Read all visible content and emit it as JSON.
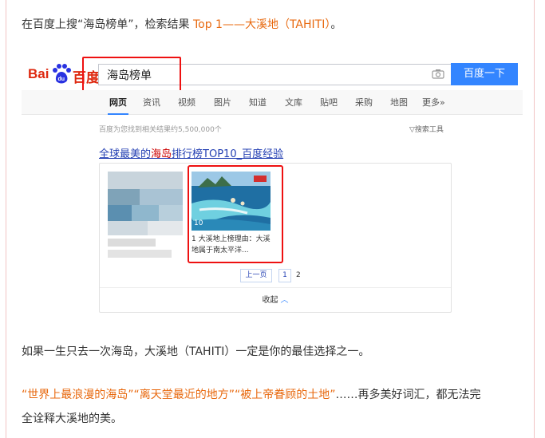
{
  "article": {
    "line1_prefix": "在百度上搜“海岛榜单”，检索结果",
    "line1_highlight": "Top 1——大溪地（TAHITI）",
    "line1_suffix": "。",
    "line2": "如果一生只去一次海岛，大溪地（TAHITI）一定是你的最佳选择之一。",
    "line3_highlight": "“世界上最浪漫的海岛”“离天堂最近的地方”“被上帝眷顾的土地”",
    "line3_suffix": "……再多美好词汇，都无法完",
    "line4": "全诠释大溪地的美。"
  },
  "baidu": {
    "logo_left": "Bai",
    "logo_right": "百度",
    "logo_du": "du",
    "query": "海岛榜单",
    "search_button": "百度一下",
    "tabs": [
      "网页",
      "资讯",
      "视频",
      "图片",
      "知道",
      "文库",
      "贴吧",
      "采购",
      "地图",
      "更多»"
    ],
    "result_count": "百度为您找到相关结果约5,500,000个",
    "search_tools": "▽搜索工具",
    "result_title_pre": "全球最美的",
    "result_title_red": "海岛",
    "result_title_post": "排行榜TOP10_百度经验",
    "thumb_badge": "10",
    "thumb_caption": "1 大溪地上榜理由：大溪地属于南太平洋...",
    "prev_page": "上一页",
    "page1": "1",
    "page2": "2",
    "collapse": "收起",
    "colors": {
      "accent": "#3385ff",
      "logo_red": "#de2910",
      "highlight_box": "#ee1111",
      "link": "#2440b3",
      "orange": "#e8690f"
    }
  }
}
